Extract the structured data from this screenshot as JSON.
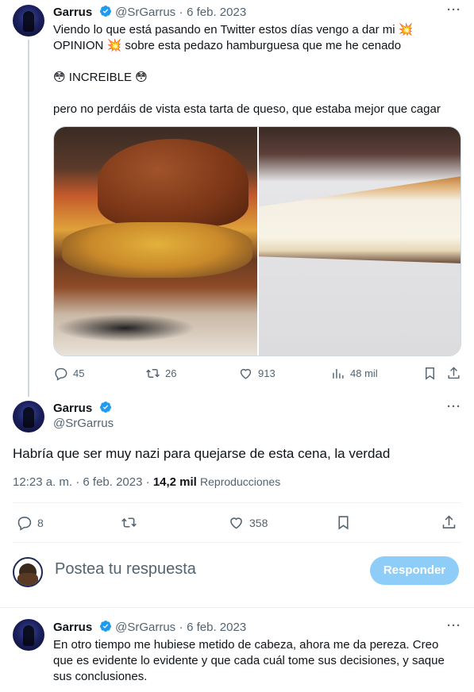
{
  "tweet1": {
    "name": "Garrus",
    "handle": "@SrGarrus",
    "dot": "·",
    "date": "6 feb. 2023",
    "line1": "Viendo lo que está pasando en Twitter estos días vengo a dar mi 💥",
    "line2": "OPINION 💥 sobre esta pedazo hamburguesa que me he cenado",
    "line3": "😳 INCREIBLE 😳",
    "line4": "pero no perdáis de vista esta tarta de queso, que estaba mejor que cagar",
    "replies": "45",
    "retweets": "26",
    "likes": "913",
    "views": "48 mil",
    "images": [
      "burger-photo",
      "cheesecake-photo"
    ]
  },
  "main_tweet": {
    "name": "Garrus",
    "handle": "@SrGarrus",
    "text": "Habría que ser muy nazi para quejarse de esta cena, la verdad",
    "time": "12:23 a. m.",
    "dot": "·",
    "date": "6 feb. 2023",
    "dot2": "·",
    "views_count": "14,2 mil",
    "views_label": "Reproducciones",
    "replies": "8",
    "likes": "358"
  },
  "composer": {
    "placeholder": "Postea tu respuesta",
    "button": "Responder"
  },
  "tweet3": {
    "name": "Garrus",
    "handle": "@SrGarrus",
    "dot": "·",
    "date": "6 feb. 2023",
    "line1": "En otro tiempo me hubiese metido de cabeza, ahora me da pereza. Creo",
    "line2": "que es evidente lo evidente y que cada cuál tome sus decisiones, y saque",
    "line3": "sus conclusiones."
  },
  "icons": {
    "verified_color": "#1d9bf0",
    "more": "···"
  }
}
